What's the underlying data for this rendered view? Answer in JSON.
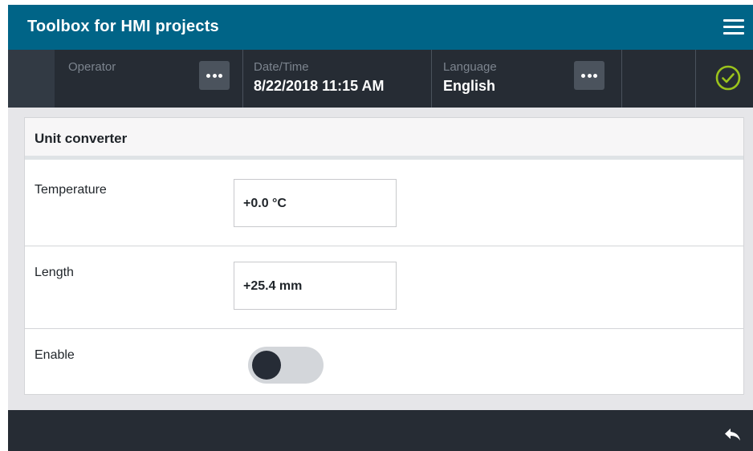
{
  "app": {
    "title": "Toolbox for HMI projects"
  },
  "statusbar": {
    "operator": {
      "label": "Operator",
      "value": ""
    },
    "datetime": {
      "label": "Date/Time",
      "value": "8/22/2018 11:15 AM"
    },
    "language": {
      "label": "Language",
      "value": "English"
    },
    "status_icon": "check-circle-icon"
  },
  "panel": {
    "title": "Unit converter",
    "rows": [
      {
        "label": "Temperature",
        "value": "+0.0 °C"
      },
      {
        "label": "Length",
        "value": "+25.4 mm"
      },
      {
        "label": "Enable",
        "toggle_on": false
      }
    ]
  },
  "bottombar": {
    "back_icon": "back-arrow-icon"
  },
  "colors": {
    "titlebar": "#006487",
    "statusbar": "#262c34",
    "check": "#9bc31c",
    "background": "#e6e6e9"
  }
}
